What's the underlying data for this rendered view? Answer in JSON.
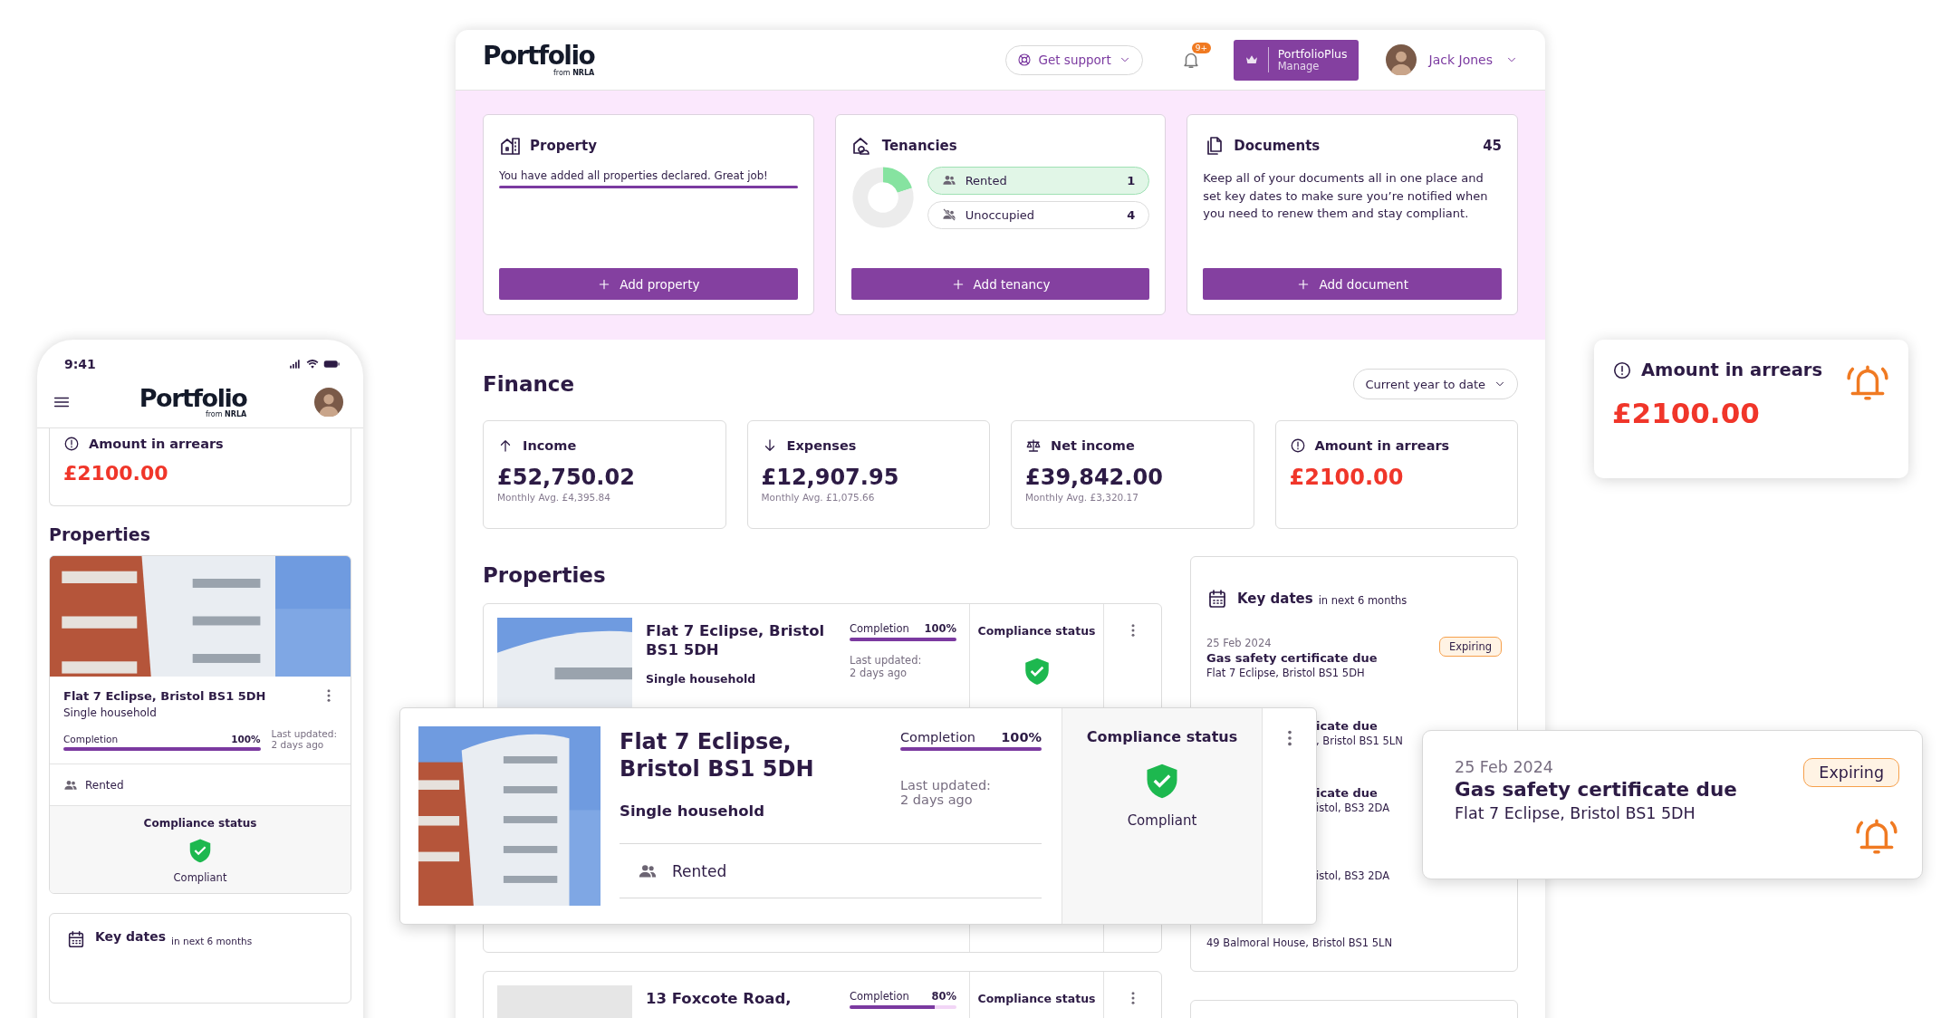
{
  "window": {
    "header": {
      "logo": "Portfolio",
      "logo_sub": "from **NRLA**",
      "support": "Get support",
      "notifications_badge": "9+",
      "plan": {
        "name": "PortfolioPlus",
        "action": "Manage"
      },
      "user": "Jack Jones"
    },
    "summary_cards": [
      {
        "kind": "property",
        "title": "Property",
        "message": "You have added all properties declared. Great job!",
        "level": 1,
        "button": "Add property"
      },
      {
        "kind": "tenancies",
        "title": "Tenancies",
        "rows": [
          {
            "kind": "rented",
            "label": "Rented",
            "count": "1",
            "highlighted": true
          },
          {
            "kind": "unoccupied",
            "label": "Unoccupied",
            "count": "4",
            "highlighted": false
          }
        ],
        "chart_data": {
          "type": "donut",
          "values": [
            20,
            80
          ],
          "colors": [
            "#86e3a0",
            "#ececec"
          ]
        },
        "button": "Add tenancy"
      },
      {
        "kind": "documents",
        "title": "Documents",
        "count": "45",
        "text": "Keep all of your documents all in one place and set key dates to make sure you’re notified when you need to renew them and stay compliant.",
        "button": "Add document"
      }
    ],
    "finance": {
      "title": "Finance",
      "period": "Current year to date",
      "cards": [
        {
          "kind": "income",
          "title": "Income",
          "amount": "£52,750.02",
          "sub": "Monthly Avg. £4,395.84"
        },
        {
          "kind": "expenses",
          "title": "Expenses",
          "amount": "£12,907.95",
          "sub": "Monthly Avg. £1,075.66"
        },
        {
          "kind": "net",
          "title": "Net income",
          "amount": "£39,842.00",
          "sub": "Monthly Avg. £3,320.17"
        },
        {
          "kind": "arrears",
          "title": "Amount in arrears",
          "amount": "£2100.00"
        }
      ]
    },
    "properties": {
      "title": "Properties",
      "items": [
        {
          "photo": true,
          "name": "Flat 7 Eclipse, Bristol BS1 5DH",
          "type": "Single household",
          "completion_label": "Completion",
          "completion": "100%",
          "level": 1,
          "updated_label": "Last updated:",
          "updated": "2 days ago",
          "compliance_label": "Compliance status"
        },
        {
          "photo": false,
          "name": "13 Foxcote Road,",
          "completion_label": "Completion",
          "completion": "80%",
          "level": 0.8,
          "compliance_label": "Compliance status"
        }
      ]
    },
    "key_dates": {
      "title": "Key dates",
      "subtitle": "in next 6 months",
      "items": [
        {
          "date": "25 Feb 2024",
          "title": "Gas safety certificate due",
          "address": "Flat 7 Eclipse, Bristol BS1 5DH",
          "badge": "Expiring",
          "covered": false
        },
        {
          "title": "icate due",
          "address": ", Bristol BS1 5LN",
          "covered": true
        },
        {
          "title": "icate due",
          "address": "istol, BS3 2DA",
          "covered": true
        },
        {
          "address": "istol, BS3 2DA",
          "covered": true
        },
        {
          "address": "49 Balmoral House, Bristol BS1 5LN",
          "covered": false
        }
      ]
    }
  },
  "phone": {
    "time": "9:41",
    "logo": "Portfolio",
    "logo_sub": "from **NRLA**",
    "arrears": {
      "title": "Amount in arrears",
      "amount": "£2100.00"
    },
    "properties_title": "Properties",
    "property": {
      "name": "Flat 7 Eclipse, Bristol BS1 5DH",
      "type": "Single household",
      "completion_label": "Completion",
      "completion": "100%",
      "level": 1,
      "updated_label": "Last updated:",
      "updated": "2 days ago",
      "status": "Rented",
      "compliance_label": "Compliance status",
      "compliance": "Compliant"
    },
    "key_dates": {
      "title": "Key dates",
      "subtitle": "in next 6 months"
    }
  },
  "zoom_property": {
    "name": "Flat 7 Eclipse, Bristol BS1 5DH",
    "type": "Single household",
    "completion_label": "Completion",
    "completion": "100%",
    "level": 1,
    "updated_label": "Last updated:",
    "updated": "2 days ago",
    "status": "Rented",
    "compliance_label": "Compliance status",
    "compliance": "Compliant"
  },
  "zoom_arrears": {
    "title": "Amount in arrears",
    "amount": "£2100.00"
  },
  "zoom_key_date": {
    "date": "25 Feb 2024",
    "title": "Gas safety certificate due",
    "address": "Flat 7 Eclipse, Bristol BS1 5DH",
    "badge": "Expiring"
  }
}
